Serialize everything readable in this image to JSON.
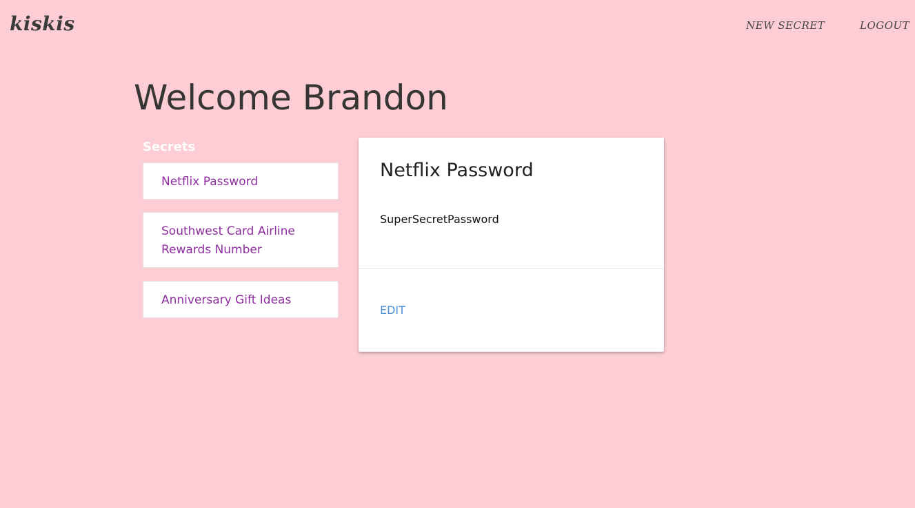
{
  "header": {
    "brand": "kiskis",
    "nav": {
      "new_secret": "NEW SECRET",
      "logout": "LOGOUT"
    }
  },
  "main": {
    "welcome": "Welcome Brandon",
    "secrets_heading": "Secrets",
    "secrets": [
      {
        "label": "Netflix Password"
      },
      {
        "label": "Southwest Card Airline Rewards Number"
      },
      {
        "label": "Anniversary Gift Ideas"
      }
    ]
  },
  "detail": {
    "title": "Netflix Password",
    "value": "SuperSecretPassword",
    "edit_label": "EDIT"
  },
  "colors": {
    "background": "#fccdd4",
    "link_purple": "#8e2ea0",
    "edit_blue": "#4a90d9"
  }
}
